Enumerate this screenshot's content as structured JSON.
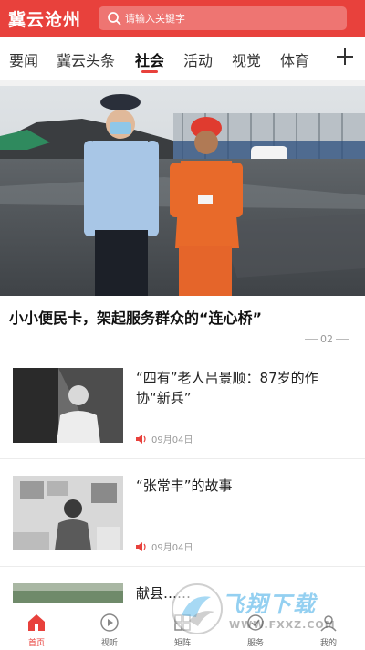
{
  "header": {
    "app_title": "冀云沧州",
    "search_placeholder": "请输入关键字"
  },
  "tabs": [
    {
      "label": "要闻"
    },
    {
      "label": "冀云头条"
    },
    {
      "label": "社会",
      "active": true
    },
    {
      "label": "活动"
    },
    {
      "label": "视觉"
    },
    {
      "label": "体育"
    }
  ],
  "hero": {
    "title": "小小便民卡，架起服务群众的“连心桥”",
    "page_indicator": "02"
  },
  "articles": [
    {
      "title": "“四有”老人吕景顺：87岁的作协“新兵”",
      "date": "09月04日"
    },
    {
      "title": "“张常丰”的故事",
      "date": "09月04日"
    },
    {
      "title": "献县……"
    }
  ],
  "bottom_nav": [
    {
      "label": "首页",
      "icon": "home-icon",
      "active": true
    },
    {
      "label": "视听",
      "icon": "play-icon"
    },
    {
      "label": "矩阵",
      "icon": "matrix-icon"
    },
    {
      "label": "服务",
      "icon": "service-icon"
    },
    {
      "label": "我的",
      "icon": "user-icon"
    }
  ],
  "watermark": {
    "text": "飞翔下载",
    "url": "WWW.FXXZ.COM"
  },
  "colors": {
    "brand": "#e8413c",
    "watermark": "#3caae6"
  }
}
